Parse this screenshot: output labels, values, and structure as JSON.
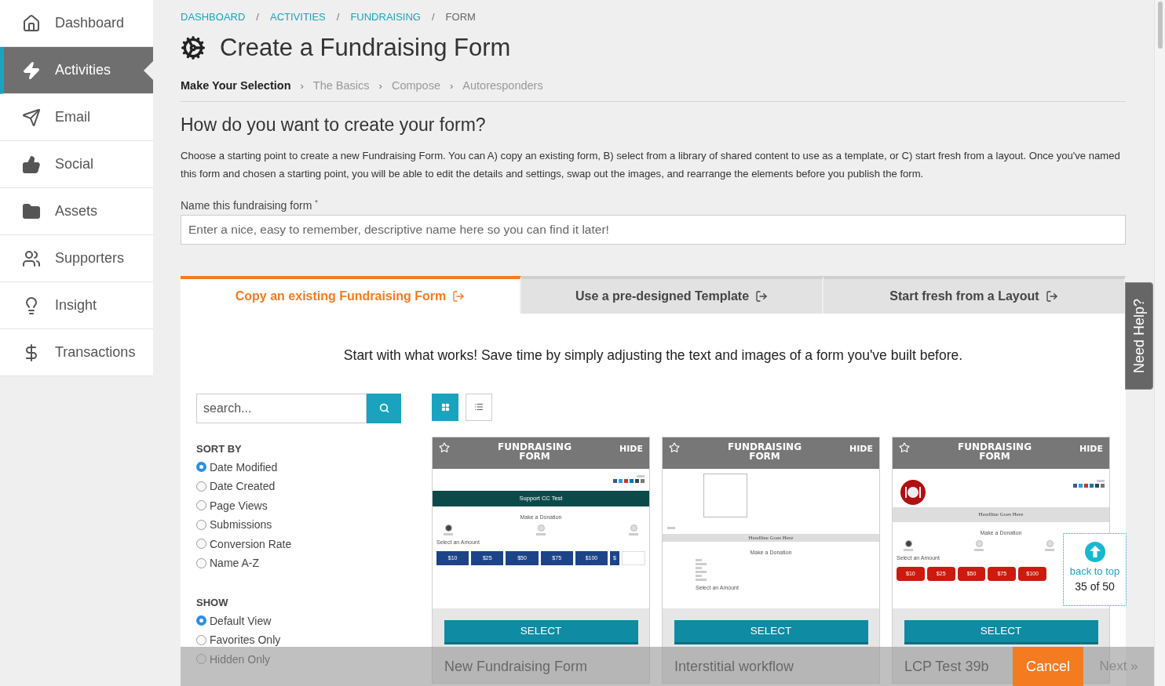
{
  "sidebar": {
    "items": [
      {
        "label": "Dashboard",
        "selected": false
      },
      {
        "label": "Activities",
        "selected": true
      },
      {
        "label": "Email",
        "selected": false
      },
      {
        "label": "Social",
        "selected": false
      },
      {
        "label": "Assets",
        "selected": false
      },
      {
        "label": "Supporters",
        "selected": false
      },
      {
        "label": "Insight",
        "selected": false
      },
      {
        "label": "Transactions",
        "selected": false
      }
    ]
  },
  "breadcrumb": [
    {
      "label": "DASHBOARD",
      "link": true
    },
    {
      "label": "ACTIVITIES",
      "link": true
    },
    {
      "label": "FUNDRAISING",
      "link": true
    },
    {
      "label": "FORM",
      "link": false
    }
  ],
  "breadcrumb_separator": "/",
  "page_title": "Create a Fundraising Form",
  "wizard_steps": [
    {
      "label": "Make Your Selection",
      "selected": true
    },
    {
      "label": "The Basics",
      "selected": false
    },
    {
      "label": "Compose",
      "selected": false
    },
    {
      "label": "Autoresponders",
      "selected": false
    }
  ],
  "wizard_separator": "›",
  "heading": "How do you want to create your form?",
  "intro": "Choose a starting point to create a new Fundraising Form. You can A) copy an existing form, B) select from a library of shared content to use as a template, or C) start fresh from a layout. Once you've named this form and chosen a starting point, you will be able to edit the details and settings, swap out the images, and rearrange the elements before you publish the form.",
  "name_field": {
    "label": "Name this fundraising form",
    "required_mark": "*",
    "placeholder": "Enter a nice, easy to remember, descriptive name here so you can find it later!"
  },
  "tabs": [
    {
      "label": "Copy an existing Fundraising Form",
      "selected": true
    },
    {
      "label": "Use a pre-designed Template",
      "selected": false
    },
    {
      "label": "Start fresh from a Layout",
      "selected": false
    }
  ],
  "tagline": "Start with what works! Save time by simply adjusting the text and images of a form you've built before.",
  "search": {
    "placeholder": "search..."
  },
  "view_modes": [
    {
      "kind": "grid",
      "selected": true
    },
    {
      "kind": "list",
      "selected": false
    }
  ],
  "sort": {
    "title": "SORT BY",
    "options": [
      {
        "label": "Date Modified",
        "selected": true
      },
      {
        "label": "Date Created",
        "selected": false
      },
      {
        "label": "Page Views",
        "selected": false
      },
      {
        "label": "Submissions",
        "selected": false
      },
      {
        "label": "Conversion Rate",
        "selected": false
      },
      {
        "label": "Name A-Z",
        "selected": false
      }
    ]
  },
  "show": {
    "title": "SHOW",
    "options": [
      {
        "label": "Default View",
        "selected": true
      },
      {
        "label": "Favorites Only",
        "selected": false
      },
      {
        "label": "Hidden Only",
        "selected": false
      }
    ]
  },
  "cards": [
    {
      "header": "FUNDRAISING FORM",
      "hide": "HIDE",
      "favorite": false,
      "button": "SELECT",
      "name": "New Fundraising Form",
      "preview": {
        "kind": "banner",
        "banner": "Support CC Test",
        "title": "Make a Donation",
        "steps": [
          {
            "active": true
          },
          {
            "active": false
          },
          {
            "active": false
          }
        ],
        "select_label": "Select an Amount",
        "amounts": [
          "$10",
          "$25",
          "$50",
          "$75",
          "$100",
          "$"
        ],
        "color": "#1e4488"
      }
    },
    {
      "header": "FUNDRAISING FORM",
      "hide": "HIDE",
      "favorite": false,
      "button": "SELECT",
      "name": "Interstitial workflow",
      "preview": {
        "kind": "image",
        "headline": "Headline Goes Here",
        "title": "Make a Donation",
        "select_label": "Select an Amount"
      }
    },
    {
      "header": "FUNDRAISING FORM",
      "hide": "HIDE",
      "favorite": false,
      "button": "SELECT",
      "name": "LCP Test 39b",
      "preview": {
        "kind": "logo",
        "headline": "Headline Goes Here",
        "title": "Make a Donation",
        "steps": [
          {
            "active": true
          },
          {
            "active": false
          },
          {
            "active": false
          }
        ],
        "select_label": "Select an Amount",
        "amounts": [
          "$10",
          "$25",
          "$50",
          "$75",
          "$100"
        ],
        "color": "#cc1a0e"
      }
    }
  ],
  "back_to_top": {
    "label": "back to top",
    "count": "35 of 50"
  },
  "need_help": "Need Help?",
  "footer": {
    "cancel": "Cancel",
    "next": {
      "label": "Next »",
      "disabled": true
    }
  }
}
